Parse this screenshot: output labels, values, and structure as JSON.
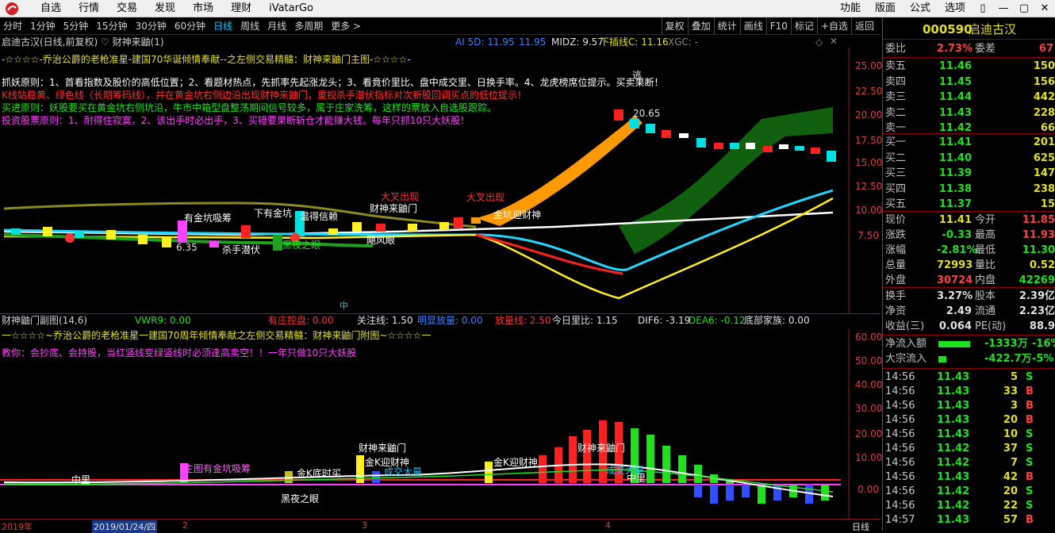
{
  "menu": {
    "items": [
      "自选",
      "行情",
      "交易",
      "发现",
      "市场",
      "理财",
      "iVatarGo"
    ],
    "right": [
      "功能",
      "版面",
      "公式",
      "选项"
    ]
  },
  "periods": {
    "items": [
      "分时",
      "1分钟",
      "5分钟",
      "15分钟",
      "30分钟",
      "60分钟",
      "日线",
      "周线",
      "月线",
      "多周期",
      "更多 >"
    ]
  },
  "toolbar": {
    "items": [
      "复权",
      "叠加",
      "统计",
      "画线",
      "F10",
      "标记",
      "+自选",
      "返回"
    ]
  },
  "main_chart": {
    "title": "启迪古汉(日线,前复权) ♡ 财神来鼬(1)",
    "ai5d": "AI 5D: 11.95",
    "ai": "11.95",
    "midz": "MIDZ: 9.57",
    "xiacha": "下插线C: 11.16",
    "xgc": "XGC: -",
    "line1": "-☆☆☆☆-乔治公爵的老枪准星-建国70华诞倾情奉献--之左侧交易精髓：财神来鼬门主图-☆☆☆☆-",
    "line2": "抓妖原则：1、首看指数及股价的高低位置；2、看题材热点，先抓率先起涨龙头；3、看竟价里比、盘中成交里、日换手率。4、龙虎榜席位提示。买卖果断！",
    "line3": "K线站稳黄、绿色线（长期筹码线），并在黄金坑右侧边沿出现财神来鼬门，重视杀手潜伏指标对次新股回调买点的低位提示！",
    "line4": "买进原则：妖股要买在黄金坑右侧坑沿，牛市中箱型盘整荡期间信号较多，属于庄家洗筹，这样的票放入自选股跟踪。",
    "line5": "投资股票原则：1、耐得住寂寞，2、该出手时必出手，3、买错要果断斩仓才能赚大钱。每年只抓10只大妖股！",
    "yticks": [
      "25.00",
      "22.50",
      "20.00",
      "17.50",
      "15.00",
      "12.50",
      "10.00",
      "7.50"
    ],
    "peak": "20.65",
    "low": "6.35",
    "labels": [
      "有金坑吸筹",
      "下有金坑",
      "杀手潜伏",
      "黑夜之眼",
      "温得信赖",
      "财神来鼬门",
      "大叉出现",
      "大叉出现",
      "金坑迎财神",
      "飓风眼",
      "逃",
      "中"
    ]
  },
  "sub_chart": {
    "title": "财神鼬门副图(14,6)",
    "vwr": "VWR9: 0.00",
    "youzhuang": "有庄控盘: 0.00",
    "guanzhu": "关注线: 1.50",
    "mingxian": "明显放量: 0.00",
    "fangliang": "放量线: 2.50",
    "jinrilb": "今日里比: 1.15",
    "dif": "DIF6: -3.19",
    "dea": "DEA6: -0.12",
    "dibu": "底部家族: 0.00",
    "line1": "一☆☆☆☆~乔治公爵的老枪准星一建国70周年倾情奉献之左侧交易精髓：财神来鼬门附图~☆☆☆☆一",
    "line2": "教你：会抄底、会持股，当红竖线变绿竖线时必须逢高卖空！！一年只做10只大妖股",
    "yticks": [
      "60.00",
      "50.00",
      "40.00",
      "30.00",
      "20.00",
      "10.00",
      "0.00"
    ],
    "labels": [
      "中里",
      "主图有金坑吸筹",
      "金K底时买",
      "黑夜之眼",
      "财神来鼬门",
      "金K迎财神",
      "成交大量",
      "金K迎财神",
      "财神来鼬门",
      "成交大量",
      "中里"
    ]
  },
  "xaxis": {
    "year": "2019年",
    "date": "2019/01/24/四",
    "ticks": [
      "2",
      "3",
      "4"
    ],
    "period": "日线"
  },
  "quote": {
    "code": "000590",
    "name": "启迪古汉",
    "weibi_label": "委比",
    "weibi": "2.73%",
    "weicha_label": "委差",
    "weicha": "67",
    "asks": [
      {
        "label": "卖五",
        "price": "11.46",
        "vol": "150"
      },
      {
        "label": "卖四",
        "price": "11.45",
        "vol": "156"
      },
      {
        "label": "卖三",
        "price": "11.44",
        "vol": "442"
      },
      {
        "label": "卖二",
        "price": "11.43",
        "vol": "228"
      },
      {
        "label": "卖一",
        "price": "11.42",
        "vol": "66"
      }
    ],
    "bids": [
      {
        "label": "买一",
        "price": "11.41",
        "vol": "201"
      },
      {
        "label": "买二",
        "price": "11.40",
        "vol": "625"
      },
      {
        "label": "买三",
        "price": "11.39",
        "vol": "147"
      },
      {
        "label": "买四",
        "price": "11.38",
        "vol": "238"
      },
      {
        "label": "买五",
        "price": "11.37",
        "vol": "15"
      }
    ],
    "stats": [
      {
        "l1": "现价",
        "v1": "11.41",
        "l2": "今开",
        "v2": "11.85",
        "c1": "#e0e020",
        "c2": "#ff4040"
      },
      {
        "l1": "涨跌",
        "v1": "-0.33",
        "l2": "最高",
        "v2": "11.93",
        "c1": "#20e020",
        "c2": "#ff4040"
      },
      {
        "l1": "涨幅",
        "v1": "-2.81%",
        "l2": "最低",
        "v2": "11.30",
        "c1": "#20e020",
        "c2": "#20e020"
      },
      {
        "l1": "总量",
        "v1": "72993",
        "l2": "量比",
        "v2": "0.52",
        "c1": "#e0e020",
        "c2": "#e0e020"
      },
      {
        "l1": "外盘",
        "v1": "30724",
        "l2": "内盘",
        "v2": "42269",
        "c1": "#ff4040",
        "c2": "#20e020"
      }
    ],
    "stats2": [
      {
        "l1": "换手",
        "v1": "3.27%",
        "l2": "股本",
        "v2": "2.39亿"
      },
      {
        "l1": "净资",
        "v1": "2.49",
        "l2": "流通",
        "v2": "2.23亿"
      },
      {
        "l1": "收益(三)",
        "v1": "0.064",
        "l2": "PE(动)",
        "v2": "88.9"
      }
    ],
    "flow": [
      {
        "label": "净流入额",
        "value": "-1333万",
        "pct": "-16%",
        "fill": 0.6
      },
      {
        "label": "大宗流入",
        "value": "-422.7万",
        "pct": "-5%",
        "fill": 0.1
      }
    ],
    "ticks": [
      {
        "t": "14:56",
        "p": "11.43",
        "v": "5",
        "s": "S"
      },
      {
        "t": "14:56",
        "p": "11.43",
        "v": "33",
        "s": "B"
      },
      {
        "t": "14:56",
        "p": "11.43",
        "v": "3",
        "s": "B"
      },
      {
        "t": "14:56",
        "p": "11.43",
        "v": "20",
        "s": "B"
      },
      {
        "t": "14:56",
        "p": "11.43",
        "v": "10",
        "s": "S"
      },
      {
        "t": "14:56",
        "p": "11.42",
        "v": "37",
        "s": "S"
      },
      {
        "t": "14:56",
        "p": "11.42",
        "v": "7",
        "s": "S"
      },
      {
        "t": "14:56",
        "p": "11.43",
        "v": "42",
        "s": "B"
      },
      {
        "t": "14:56",
        "p": "11.42",
        "v": "20",
        "s": "S"
      },
      {
        "t": "14:56",
        "p": "11.42",
        "v": "22",
        "s": "S"
      },
      {
        "t": "14:57",
        "p": "11.43",
        "v": "57",
        "s": "B"
      }
    ]
  }
}
